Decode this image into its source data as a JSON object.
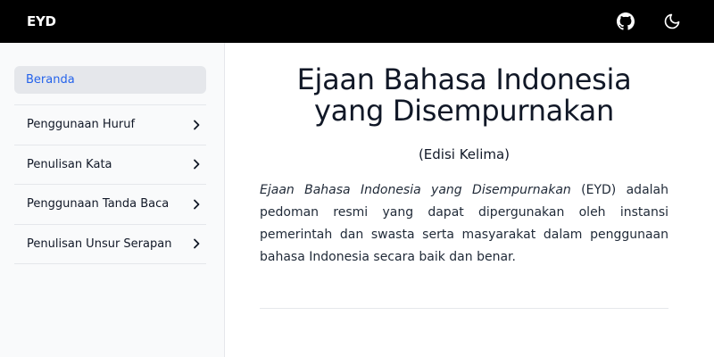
{
  "header": {
    "brand": "EYD",
    "icons": [
      "github-icon",
      "moon-icon"
    ]
  },
  "sidebar": {
    "active_item": "Beranda",
    "items": [
      {
        "label": "Penggunaan Huruf"
      },
      {
        "label": "Penulisan Kata"
      },
      {
        "label": "Penggunaan Tanda Baca"
      },
      {
        "label": "Penulisan Unsur Serapan"
      }
    ]
  },
  "main": {
    "title_line1": "Ejaan Bahasa Indonesia",
    "title_line2": "yang Disempurnakan",
    "subtitle": "(Edisi Kelima)",
    "intro_italic": "Ejaan Bahasa Indonesia yang Disempurnakan",
    "intro_rest": " (EYD) adalah pedoman resmi yang dapat dipergunakan oleh instansi pemerintah dan swasta serta masyarakat dalam penggunaan bahasa Indonesia secara baik dan benar."
  },
  "colors": {
    "topbar": "#000000",
    "accent": "#2563eb",
    "sidebar_bg": "#f9fafb",
    "active_bg": "#e5e7eb"
  }
}
